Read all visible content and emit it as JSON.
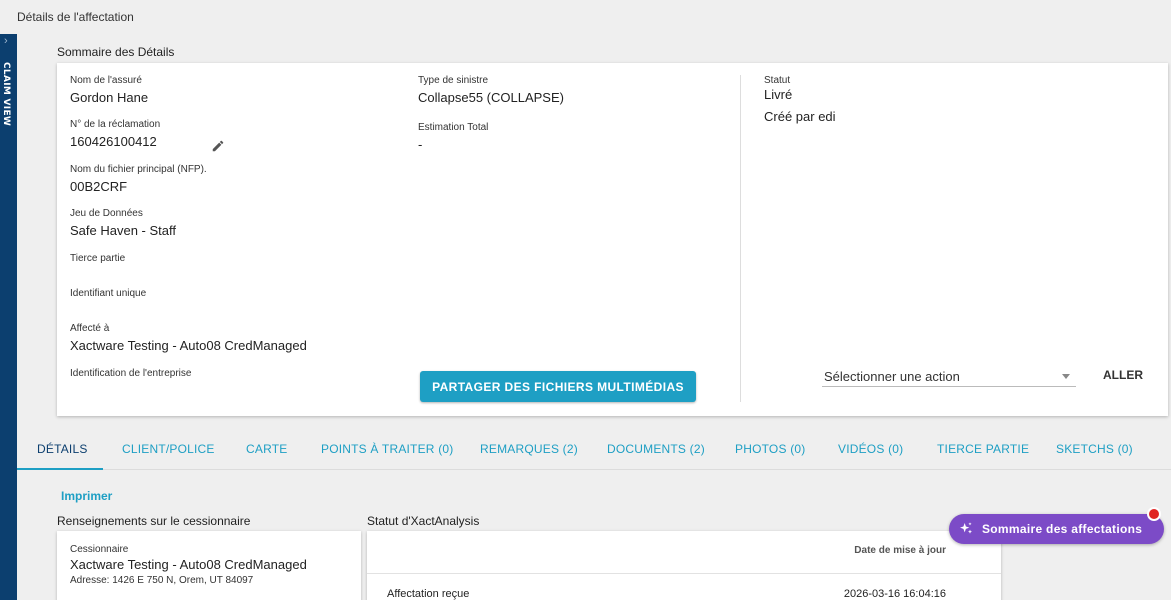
{
  "page": {
    "title": "Détails de l'affectation"
  },
  "rail": {
    "label": "CLAIM VIEW"
  },
  "summary": {
    "title": "Sommaire des Détails",
    "insured_label": "Nom de l'assuré",
    "insured_value": "Gordon Hane",
    "claim_label": "N° de la réclamation",
    "claim_value": "160426100412",
    "file_label": "Nom du fichier principal (NFP).",
    "file_value": "00B2CRF",
    "dataset_label": "Jeu de Données",
    "dataset_value": "Safe Haven - Staff",
    "third_party_label": "Tierce partie",
    "unique_id_label": "Identifiant unique",
    "assigned_label": "Affecté à",
    "assigned_value": "Xactware Testing - Auto08 CredManaged",
    "company_label": "Identification de l'entreprise",
    "loss_type_label": "Type de sinistre",
    "loss_type_value": "Collapse55 (COLLAPSE)",
    "estimate_label": "Estimation Total",
    "estimate_value": "-",
    "status_label": "Statut",
    "status_value": "Livré",
    "created_by": "Créé par edi",
    "share_button": "PARTAGER DES FICHIERS MULTIMÉDIAS",
    "action_select": "Sélectionner une action",
    "go_button": "ALLER"
  },
  "tabs": [
    "DÉTAILS",
    "CLIENT/POLICE",
    "CARTE",
    "POINTS À TRAITER (0)",
    "REMARQUES (2)",
    "DOCUMENTS (2)",
    "PHOTOS (0)",
    "VIDÉOS (0)",
    "TIERCE PARTIE",
    "SKETCHS (0)"
  ],
  "print_link": "Imprimer",
  "assignee": {
    "title": "Renseignements sur le cessionnaire",
    "label": "Cessionnaire",
    "name": "Xactware Testing - Auto08 CredManaged",
    "address": "Adresse: 1426 E 750 N, Orem, UT 84097"
  },
  "xact": {
    "title": "Statut d'XactAnalysis",
    "column_header": "Date de mise à jour",
    "rows": [
      {
        "label": "Affectation reçue",
        "date": "2026-03-16 16:04:16"
      }
    ]
  },
  "fab": {
    "label": "Sommaire des affectations",
    "icon": "sparkle-icon"
  },
  "colors": {
    "accent": "#1e9fc4",
    "rail": "#0c3f6f",
    "fab": "#7c4bc7",
    "notification": "#e02424"
  }
}
